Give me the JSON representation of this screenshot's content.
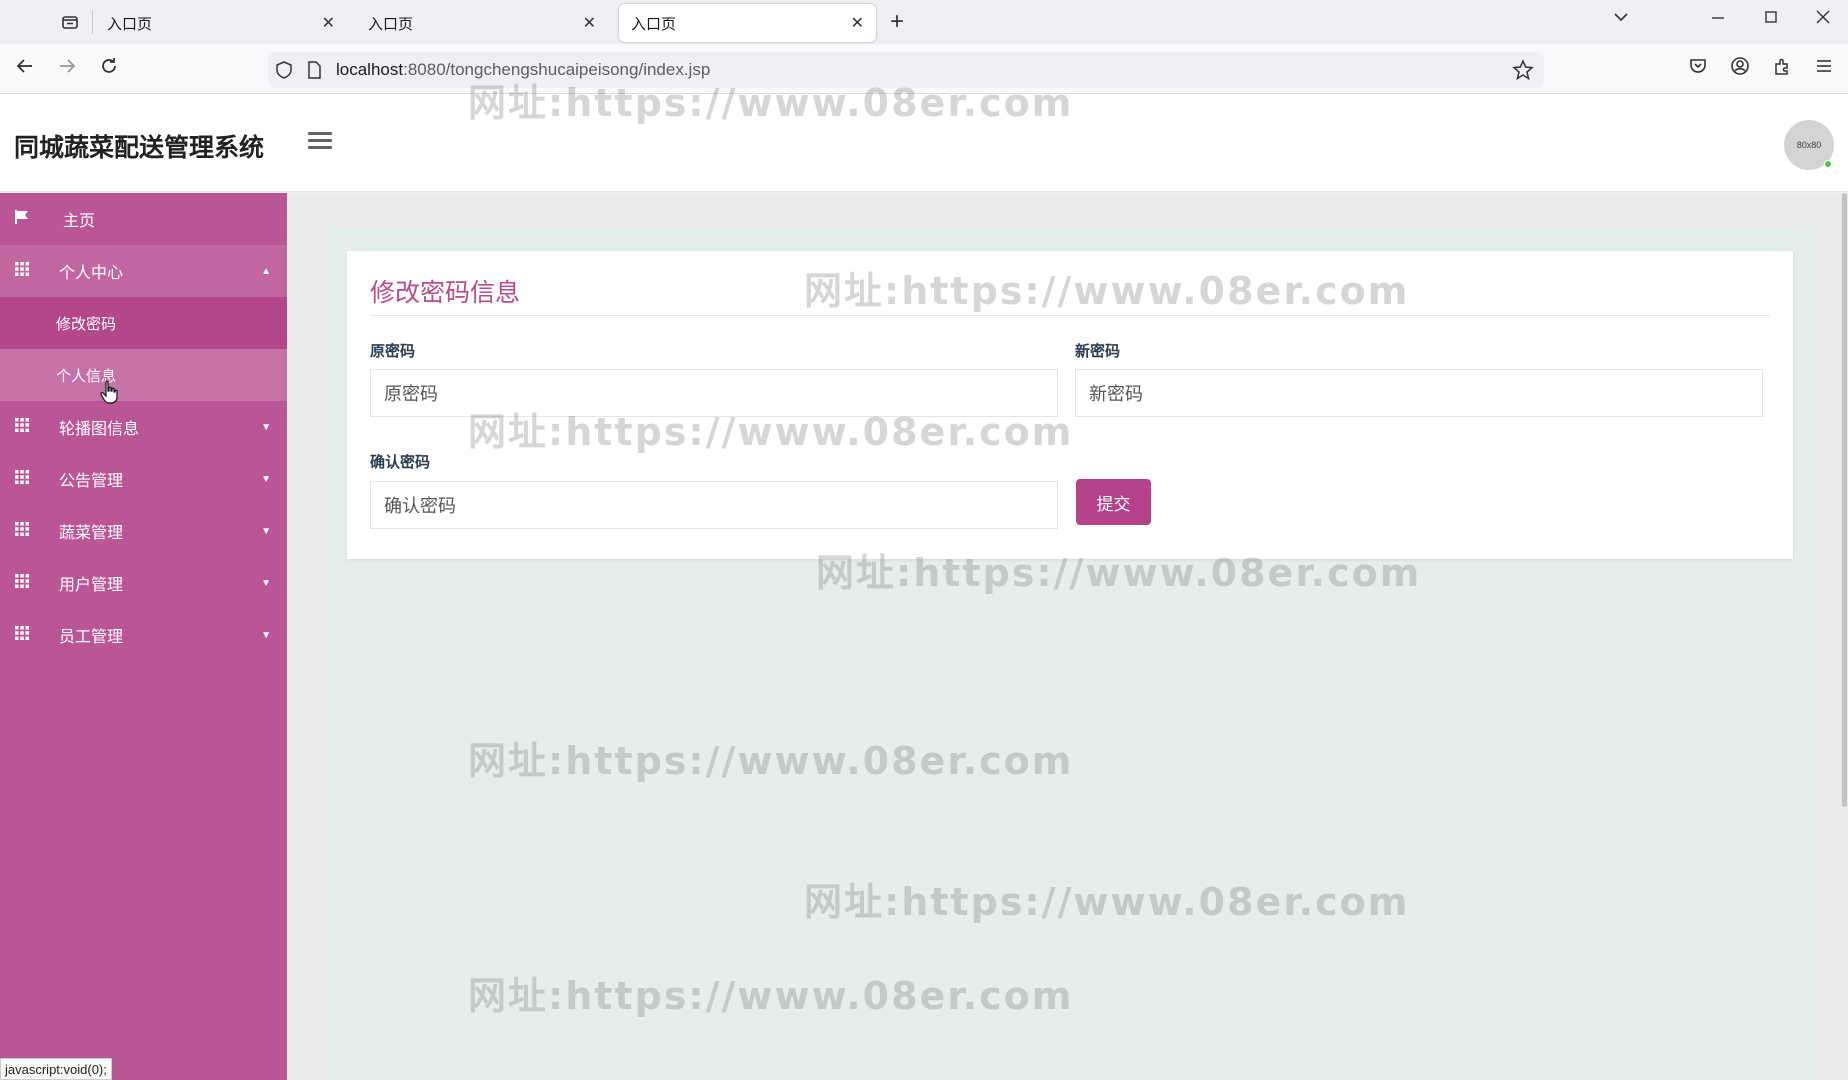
{
  "browser": {
    "tabs": [
      {
        "label": "入口页",
        "close": "✕"
      },
      {
        "label": "入口页",
        "close": "✕"
      },
      {
        "label": "入口页",
        "close": "✕"
      }
    ],
    "url_host": "localhost",
    "url_path": ":8080/tongchengshucaipeisong/index.jsp",
    "status_text": "javascript:void(0);"
  },
  "header": {
    "brand": "同城蔬菜配送管理系统",
    "avatar_text": "80x80"
  },
  "sidebar": {
    "items": [
      {
        "label": "主页",
        "icon": "flag-icon"
      },
      {
        "label": "个人中心",
        "icon": "grid-icon",
        "expanded": true,
        "children": [
          {
            "label": "修改密码"
          },
          {
            "label": "个人信息"
          }
        ]
      },
      {
        "label": "轮播图信息",
        "icon": "grid-icon"
      },
      {
        "label": "公告管理",
        "icon": "grid-icon"
      },
      {
        "label": "蔬菜管理",
        "icon": "grid-icon"
      },
      {
        "label": "用户管理",
        "icon": "grid-icon"
      },
      {
        "label": "员工管理",
        "icon": "grid-icon"
      }
    ]
  },
  "form": {
    "title": "修改密码信息",
    "old_password": {
      "label": "原密码",
      "placeholder": "原密码"
    },
    "new_password": {
      "label": "新密码",
      "placeholder": "新密码"
    },
    "confirm_password": {
      "label": "确认密码",
      "placeholder": "确认密码"
    },
    "submit_label": "提交"
  },
  "watermark": "网址:https://www.08er.com",
  "colors": {
    "sidebar": "#bb5696",
    "accent": "#b4428a",
    "panel": "#e4efea"
  }
}
